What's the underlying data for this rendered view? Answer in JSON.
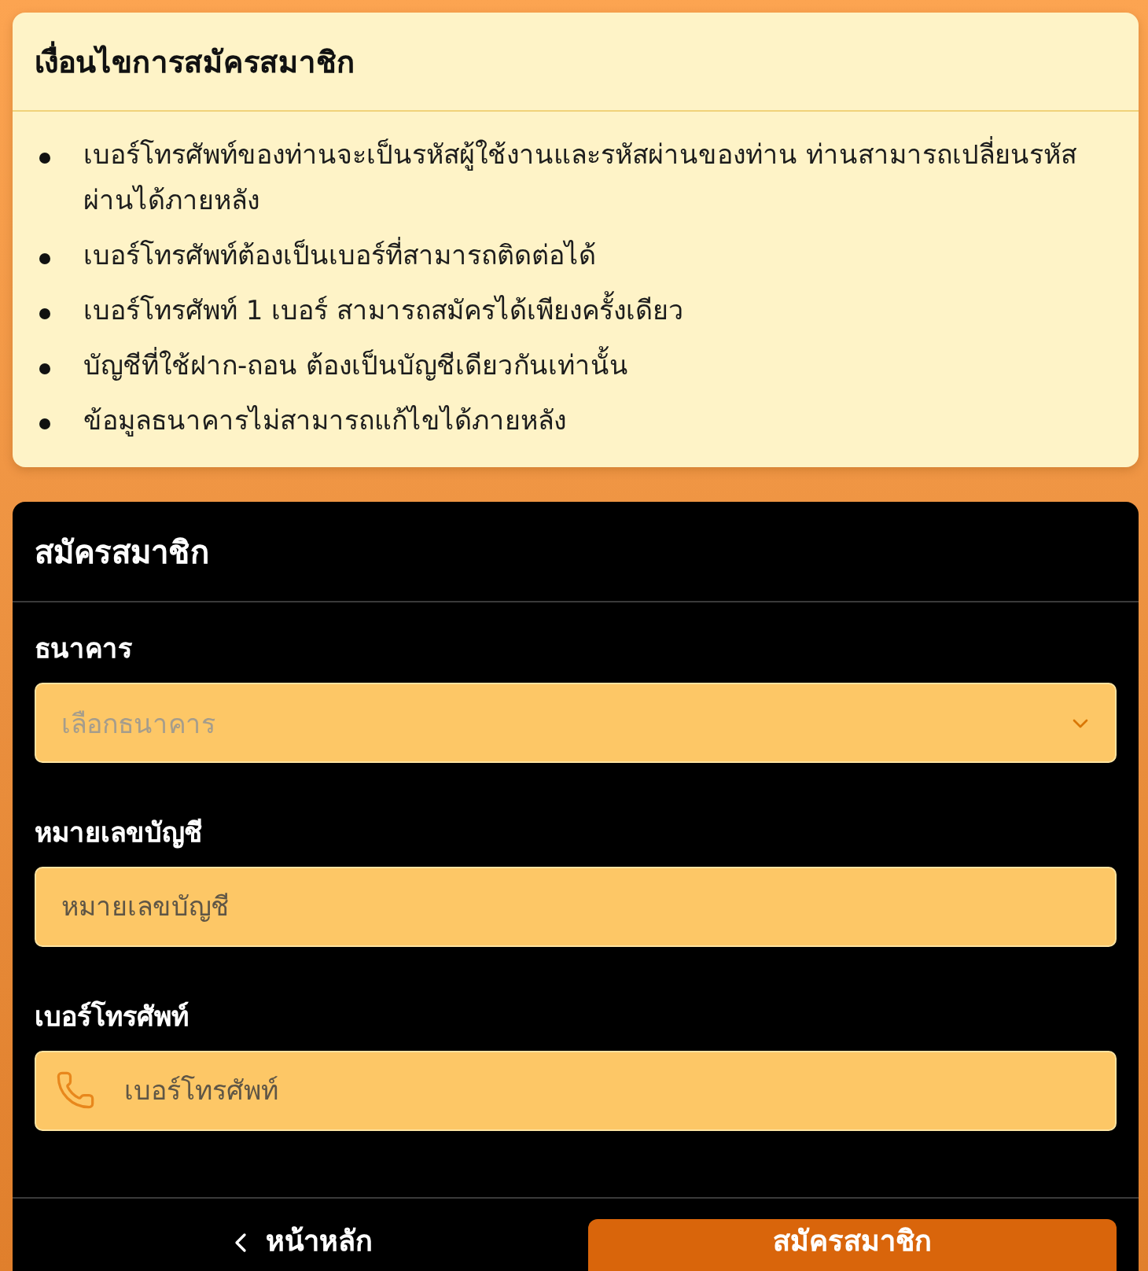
{
  "terms": {
    "title": "เงื่อนไขการสมัครสมาชิก",
    "items": [
      "เบอร์โทรศัพท์ของท่านจะเป็นรหัสผู้ใช้งานและรหัสผ่านของท่าน ท่านสามารถเปลี่ยนรหัสผ่านได้ภายหลัง",
      "เบอร์โทรศัพท์ต้องเป็นเบอร์ที่สามารถติดต่อได้",
      "เบอร์โทรศัพท์ 1 เบอร์ สามารถสมัครได้เพียงครั้งเดียว",
      "บัญชีที่ใช้ฝาก-ถอน ต้องเป็นบัญชีเดียวกันเท่านั้น",
      "ข้อมูลธนาคารไม่สามารถแก้ไขได้ภายหลัง"
    ]
  },
  "form": {
    "title": "สมัครสมาชิก",
    "fields": [
      {
        "kind": "select",
        "label": "ธนาคาร",
        "placeholder": "เลือกธนาคาร"
      },
      {
        "kind": "text",
        "label": "หมายเลขบัญชี",
        "placeholder": "หมายเลขบัญชี"
      },
      {
        "kind": "phone",
        "label": "เบอร์โทรศัพท์",
        "placeholder": "เบอร์โทรศัพท์"
      }
    ],
    "buttons": [
      {
        "kind": "back",
        "label": "หน้าหลัก"
      },
      {
        "kind": "primary",
        "label": "สมัครสมาชิก"
      }
    ]
  }
}
